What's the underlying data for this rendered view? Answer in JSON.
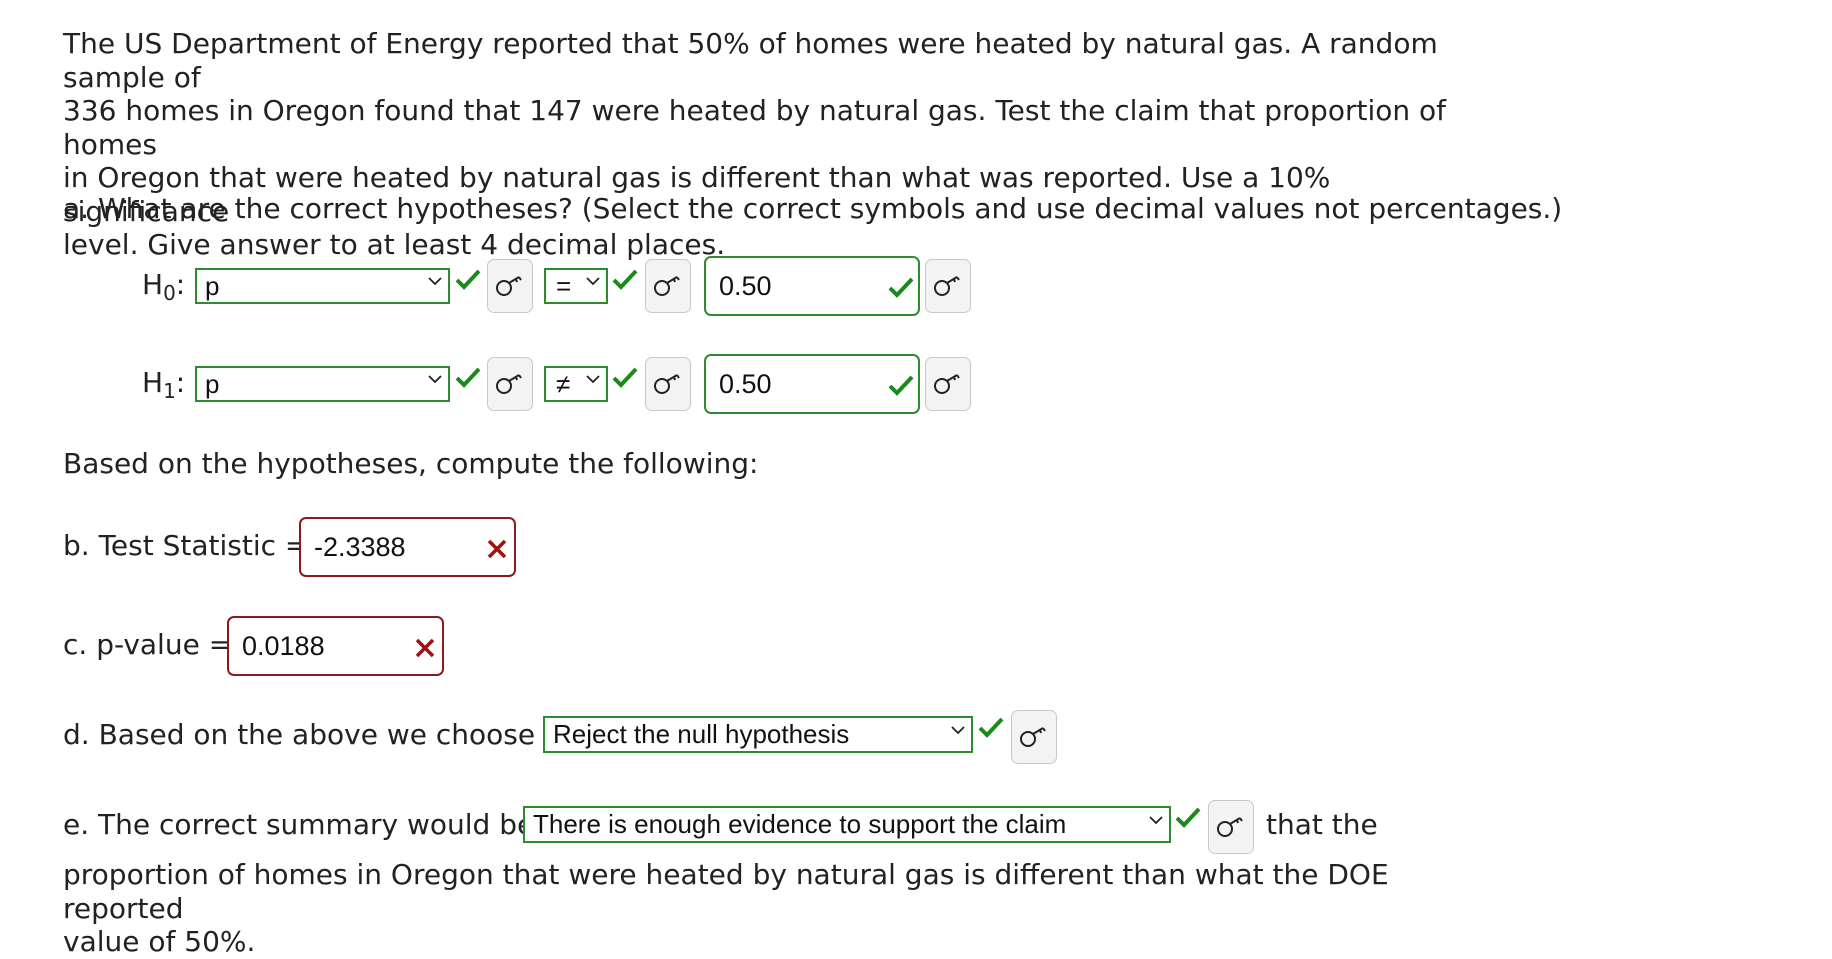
{
  "problem": {
    "lines": [
      "The US Department of Energy reported that 50% of homes were heated by natural gas. A random sample of",
      "336 homes in Oregon found that 147 were heated by natural gas. Test the claim that proportion of homes",
      "in Oregon that were heated by natural gas is different than what was reported. Use a 10% significance",
      "level. Give answer to at least 4 decimal places."
    ]
  },
  "part_a": {
    "prompt": "a. What are the correct hypotheses? (Select the correct symbols and use decimal values not percentages.)",
    "h0": {
      "label": "H",
      "sub": "0",
      "colon": ":",
      "param": "p",
      "symbol": "=",
      "value": "0.50"
    },
    "h1": {
      "label": "H",
      "sub": "1",
      "colon": ":",
      "param": "p",
      "symbol": "≠",
      "value": "0.50"
    }
  },
  "compute_prompt": "Based on the hypotheses, compute the following:",
  "part_b": {
    "label": "b. Test Statistic =",
    "value": "-2.3388"
  },
  "part_c": {
    "label": "c. p-value =",
    "value": "0.0188"
  },
  "part_d": {
    "label": "d. Based on the above we choose to",
    "selected": "Reject the null hypothesis"
  },
  "part_e": {
    "label": "e. The correct summary would be:",
    "selected": "There is enough evidence to support the claim",
    "after": "that the",
    "continuation": [
      "proportion of homes in Oregon that were heated by natural gas is different than what the DOE reported",
      "value of 50%."
    ]
  },
  "colors": {
    "correct": "#1a8a1a",
    "incorrect": "#a01010",
    "box_green": "#2e8b2e",
    "box_red": "#8b1a1a"
  },
  "icons": {
    "correct": "check-icon",
    "incorrect": "cross-icon",
    "answer_key": "key-icon",
    "dropdown": "chevron-down-icon"
  }
}
